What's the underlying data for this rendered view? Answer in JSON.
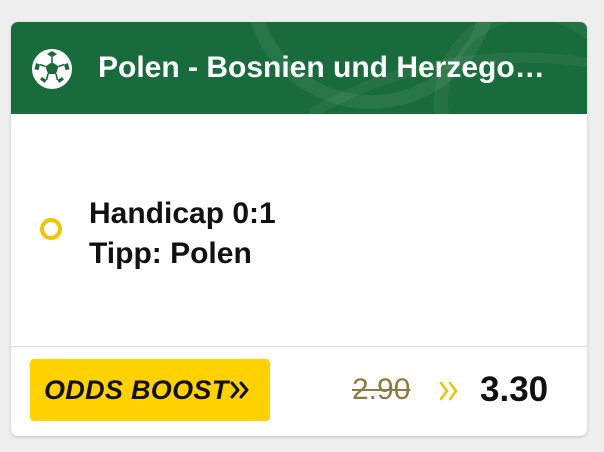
{
  "event": {
    "title": "Polen - Bosnien und Herzegowina",
    "sport_icon": "soccer-ball-icon"
  },
  "selection": {
    "market": "Handicap 0:1",
    "tip": "Tipp: Polen"
  },
  "boost": {
    "label": "ODDS BOOST",
    "old_odds": "2.90",
    "new_odds": "3.30"
  },
  "colors": {
    "header_green": "#186b3a",
    "boost_yellow": "#ffd200",
    "radio_yellow": "#f2c400",
    "old_odds_color": "#8d7b3c"
  }
}
